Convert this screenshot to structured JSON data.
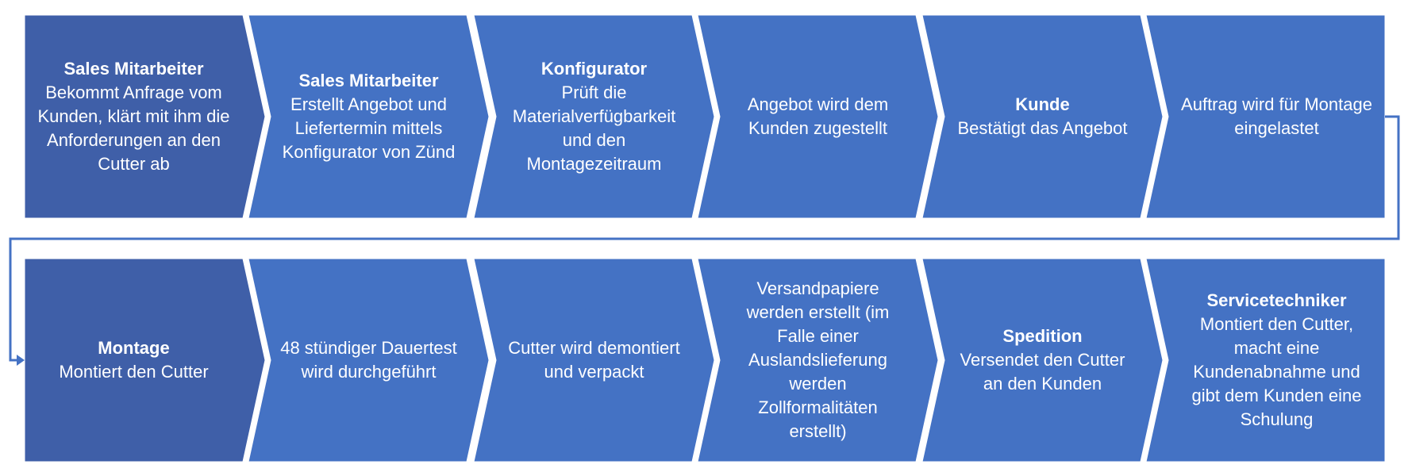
{
  "colors": {
    "step": "#4472C4",
    "step_first": "#3F5FA8",
    "connector": "#4472C4",
    "text": "#FFFFFF"
  },
  "rows": [
    {
      "steps": [
        {
          "title": "Sales Mitarbeiter",
          "text": "Bekommt Anfrage vom Kunden, klärt mit ihm die Anforderungen an den Cutter ab",
          "first": true
        },
        {
          "title": "Sales Mitarbeiter",
          "text": "Erstellt Angebot und Liefertermin mittels Konfigurator von Zünd"
        },
        {
          "title": "Konfigurator",
          "text": "Prüft die Materialverfügbarkeit und den Montagezeitraum"
        },
        {
          "title": "",
          "text": "Angebot wird dem Kunden zugestellt"
        },
        {
          "title": "Kunde",
          "text": "Bestätigt das Angebot"
        },
        {
          "title": "",
          "text": "Auftrag wird für Montage eingelastet",
          "last": true
        }
      ]
    },
    {
      "steps": [
        {
          "title": "Montage",
          "text": "Montiert den Cutter",
          "first": true
        },
        {
          "title": "",
          "text": "48 stündiger Dauertest wird durchgeführt"
        },
        {
          "title": "",
          "text": "Cutter wird demontiert und verpackt"
        },
        {
          "title": "",
          "text": "Versandpapiere werden erstellt (im Falle einer Auslandslieferung werden Zollformalitäten erstellt)"
        },
        {
          "title": "Spedition",
          "text": "Versendet den Cutter an den Kunden"
        },
        {
          "title": "Servicetechniker",
          "text": "Montiert den Cutter, macht eine Kundenabnahme und gibt dem Kunden eine Schulung",
          "last": true
        }
      ]
    }
  ]
}
